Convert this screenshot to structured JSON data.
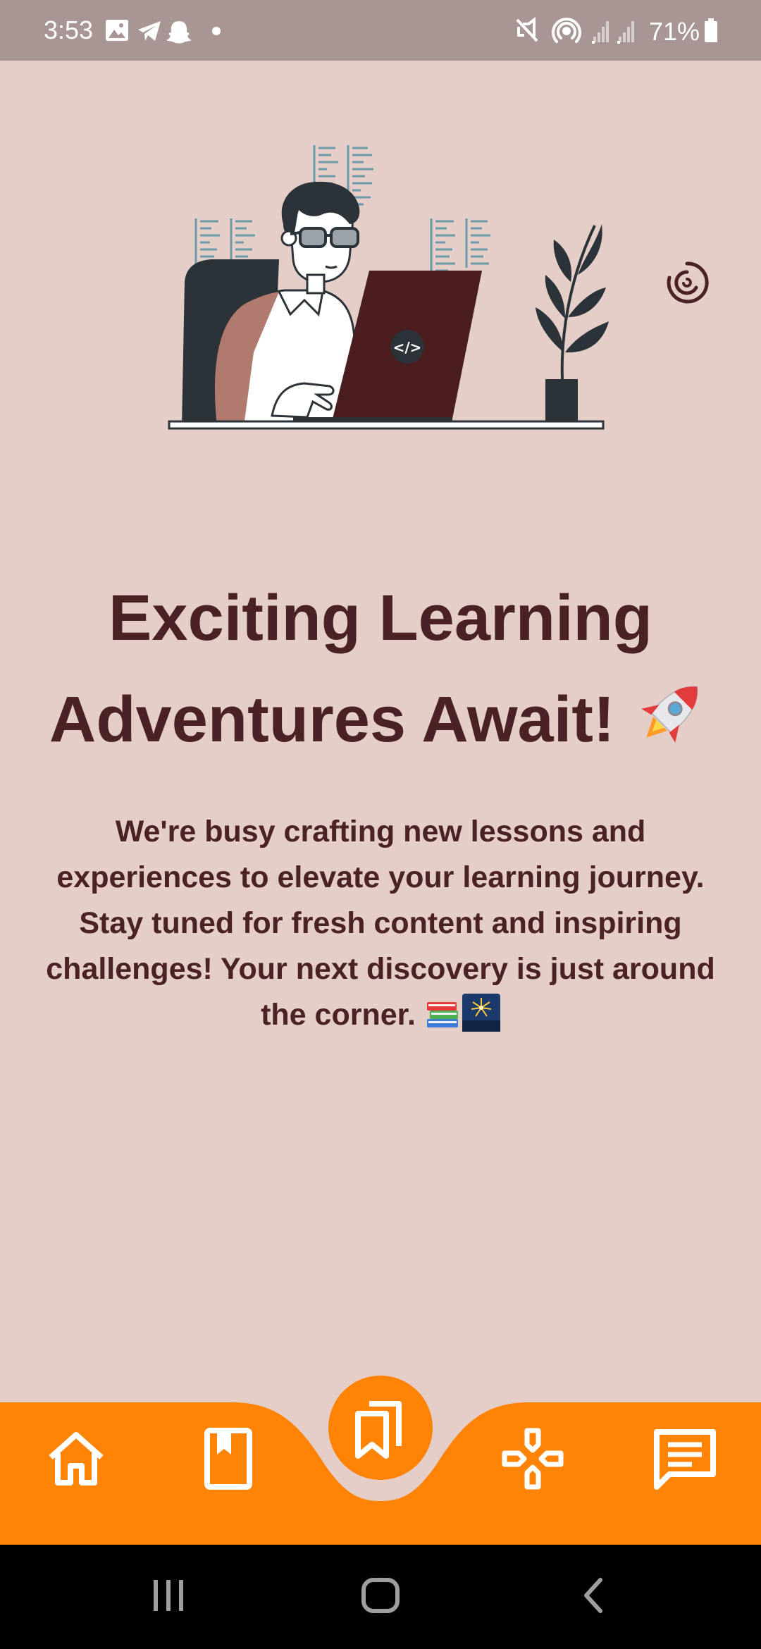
{
  "status_bar": {
    "time": "3:53",
    "battery_text": "71%",
    "left_icons": [
      "gallery-icon",
      "telegram-icon",
      "snapchat-icon",
      "dot-icon"
    ],
    "right_icons": [
      "mute-vibrate-icon",
      "hotspot-icon",
      "signal-icon",
      "signal-icon",
      "battery-icon"
    ]
  },
  "hero": {
    "illustration": "developer-at-laptop-illustration",
    "laptop_code_symbol": "</>"
  },
  "content": {
    "headline_line1": "Exciting Learning",
    "headline_line2": "Adventures Await!",
    "headline_emoji": "rocket",
    "description": "We're busy crafting new lessons and experiences to elevate your learning journey. Stay tuned for fresh content and inspiring challenges! Your next discovery is just around the corner.",
    "description_emojis": [
      "books",
      "fireworks"
    ]
  },
  "bottom_nav": {
    "items": [
      "home-icon",
      "book-icon",
      "bookmarks-icon",
      "gamepad-icon",
      "message-icon"
    ],
    "active": "bookmarks-icon"
  },
  "colors": {
    "background": "#e5cdc8",
    "status_bar": "#a89694",
    "text": "#4a2124",
    "accent_orange": "#ff8305",
    "nav_bar": "#000000"
  }
}
